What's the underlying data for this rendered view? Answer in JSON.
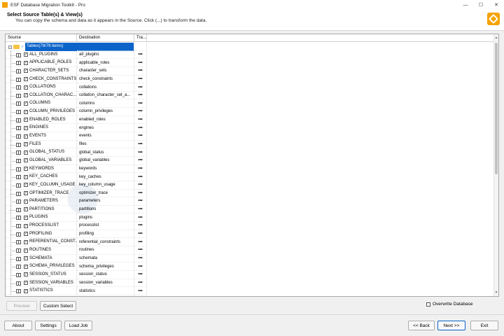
{
  "window": {
    "title": "ESF Database Migration Toolkit - Pro",
    "controls": [
      "—",
      "☐",
      "✕"
    ]
  },
  "header": {
    "title": "Select Source Table(s) & View(s)",
    "subtitle": "You can copy the schema and data as it appears in the Source. Click (...) to transform the data."
  },
  "grid": {
    "columns": [
      "Source",
      "Destination",
      "Tra..."
    ],
    "root": {
      "label": "Tables(79/79 items)",
      "expander": "-",
      "checked": "✓"
    },
    "action_glyph": "•••",
    "check_glyph": "✓",
    "rows": [
      {
        "source": "ALL_PLUGINS",
        "dest": "all_plugins"
      },
      {
        "source": "APPLICABLE_ROLES",
        "dest": "applicable_roles"
      },
      {
        "source": "CHARACTER_SETS",
        "dest": "character_sets"
      },
      {
        "source": "CHECK_CONSTRAINTS",
        "dest": "check_constraints"
      },
      {
        "source": "COLLATIONS",
        "dest": "collations"
      },
      {
        "source": "COLLATION_CHARAC...",
        "dest": "collation_character_set_a..."
      },
      {
        "source": "COLUMNS",
        "dest": "columns"
      },
      {
        "source": "COLUMN_PRIVILEGES",
        "dest": "column_privileges"
      },
      {
        "source": "ENABLED_ROLES",
        "dest": "enabled_roles"
      },
      {
        "source": "ENGINES",
        "dest": "engines"
      },
      {
        "source": "EVENTS",
        "dest": "events"
      },
      {
        "source": "FILES",
        "dest": "files"
      },
      {
        "source": "GLOBAL_STATUS",
        "dest": "global_status"
      },
      {
        "source": "GLOBAL_VARIABLES",
        "dest": "global_variables"
      },
      {
        "source": "KEYWORDS",
        "dest": "keywords"
      },
      {
        "source": "KEY_CACHES",
        "dest": "key_caches"
      },
      {
        "source": "KEY_COLUMN_USAGE",
        "dest": "key_column_usage"
      },
      {
        "source": "OPTIMIZER_TRACE",
        "dest": "optimizer_trace"
      },
      {
        "source": "PARAMETERS",
        "dest": "parameters"
      },
      {
        "source": "PARTITIONS",
        "dest": "partitions"
      },
      {
        "source": "PLUGINS",
        "dest": "plugins"
      },
      {
        "source": "PROCESSLIST",
        "dest": "processlist"
      },
      {
        "source": "PROFILING",
        "dest": "profiling"
      },
      {
        "source": "REFERENTIAL_CONST...",
        "dest": "referential_constraints"
      },
      {
        "source": "ROUTINES",
        "dest": "routines"
      },
      {
        "source": "SCHEMATA",
        "dest": "schemata"
      },
      {
        "source": "SCHEMA_PRIVILEGES",
        "dest": "schema_privileges"
      },
      {
        "source": "SESSION_STATUS",
        "dest": "session_status"
      },
      {
        "source": "SESSION_VARIABLES",
        "dest": "session_variables"
      },
      {
        "source": "STATISTICS",
        "dest": "statistics"
      }
    ]
  },
  "actions": {
    "preview": "Preview",
    "custom_select": "Custom Select",
    "overwrite_database": "Overwrite Database"
  },
  "footer": {
    "about": "About",
    "settings": "Settings",
    "load_job": "Load Job",
    "back": "<< Back",
    "next": "Next >>",
    "exit": "Exit"
  },
  "colors": {
    "selection": "#0b63c9",
    "brand": "#f5a300"
  }
}
